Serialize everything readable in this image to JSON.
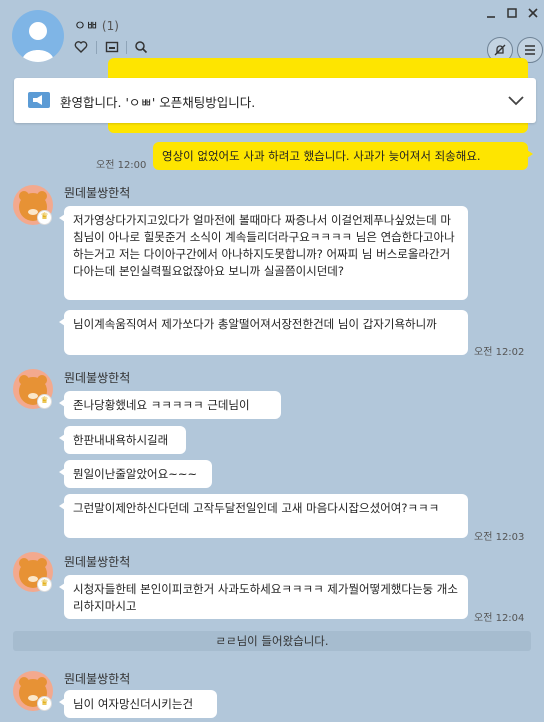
{
  "header": {
    "room_name": "ㅇㅃ",
    "member_count": "(1)",
    "icons": [
      "heart-icon",
      "folder-icon",
      "search-icon",
      "mute-icon",
      "menu-icon"
    ]
  },
  "notice": {
    "text": "환영합니다. 'ㅇㅃ' 오픈채팅방입니다."
  },
  "messages": {
    "mine1": {
      "text": "영상이 없었어도 사과 하려고 했습니다. 사과가 늦어져서 죄송해요.",
      "time": "오전 12:00"
    },
    "group1": {
      "sender": "뭔데불쌍한척",
      "m1": "저가영상다가지고있다가 얼마전에 볼때마다 짜증나서 이걸언제푸나싶었는데 마침님이 아나로 힐못준거 소식이 계속들리더라구요ㅋㅋㅋㅋ 님은 연습한다고아나하는거고 저는 다이아구간에서 아나하지도못합니까? 어짜피 님 버스로올라간거 다아는데 본인실력필요없잖아요 보니까 실골쯤이시던데?",
      "m2": "님이계속움직여서 제가쏘다가 총알떨어져서장전한건데 님이 갑자기욕하니까",
      "time": "오전 12:02"
    },
    "group2": {
      "sender": "뭔데불쌍한척",
      "m1": "존나당황했네요 ㅋㅋㅋㅋㅋ 근데님이",
      "m2": "한판내내욕하시길래",
      "m3": "뭔일이난줄알았어요~~~",
      "m4": "그런말이제안하신다던데 고작두달전일인데 고새 마음다시잡으셨어여?ㅋㅋㅋ",
      "time": "오전 12:03"
    },
    "group3": {
      "sender": "뭔데불쌍한척",
      "m1": "시청자들한테 본인이피코한거 사과도하세요ㅋㅋㅋㅋ 제가뭘어떻게했다는둥 개소리하지마시고",
      "time": "오전 12:04"
    },
    "system": "ㄹㄹ님이 들어왔습니다.",
    "group4": {
      "sender": "뭔데불쌍한척",
      "m1": "님이 여자망신더시키는건"
    }
  },
  "colors": {
    "background": "#b2c7da",
    "my_bubble": "#fee500",
    "other_bubble": "#ffffff"
  }
}
